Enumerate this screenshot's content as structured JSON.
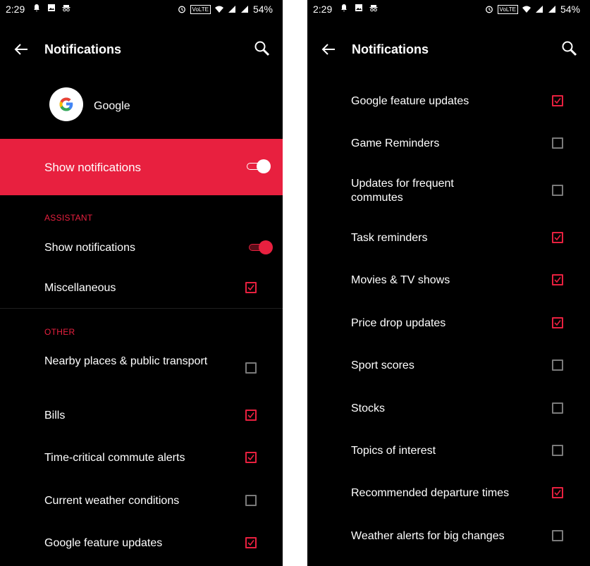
{
  "status_bar": {
    "time": "2:29",
    "network_badge": "VoLTE",
    "battery": "54%"
  },
  "app_bar": {
    "title": "Notifications"
  },
  "app": {
    "name": "Google"
  },
  "main_toggle": {
    "label": "Show notifications",
    "on": true
  },
  "left_screen": {
    "assistant_header": "ASSISTANT",
    "assistant_items": [
      {
        "label": "Show notifications",
        "type": "switch",
        "on": true
      },
      {
        "label": "Miscellaneous",
        "type": "checkbox",
        "checked": true
      }
    ],
    "other_header": "OTHER",
    "other_items": [
      {
        "label": "Nearby places & public transport",
        "checked": false
      },
      {
        "label": "Bills",
        "checked": true
      },
      {
        "label": "Time-critical commute alerts",
        "checked": true
      },
      {
        "label": "Current weather conditions",
        "checked": false
      },
      {
        "label": "Google feature updates",
        "checked": true
      }
    ]
  },
  "right_screen": {
    "items": [
      {
        "label": "Google feature updates",
        "checked": true
      },
      {
        "label": "Game Reminders",
        "checked": false
      },
      {
        "label": "Updates for frequent commutes",
        "checked": false
      },
      {
        "label": "Task reminders",
        "checked": true
      },
      {
        "label": "Movies & TV shows",
        "checked": true
      },
      {
        "label": "Price drop updates",
        "checked": true
      },
      {
        "label": "Sport scores",
        "checked": false
      },
      {
        "label": "Stocks",
        "checked": false
      },
      {
        "label": "Topics of interest",
        "checked": false
      },
      {
        "label": "Recommended departure times",
        "checked": true
      },
      {
        "label": "Weather alerts for big changes",
        "checked": false
      }
    ]
  },
  "colors": {
    "accent": "#e8203f",
    "background": "#000000",
    "text": "#ffffff",
    "checkbox_unchecked": "#7a7a7a"
  }
}
